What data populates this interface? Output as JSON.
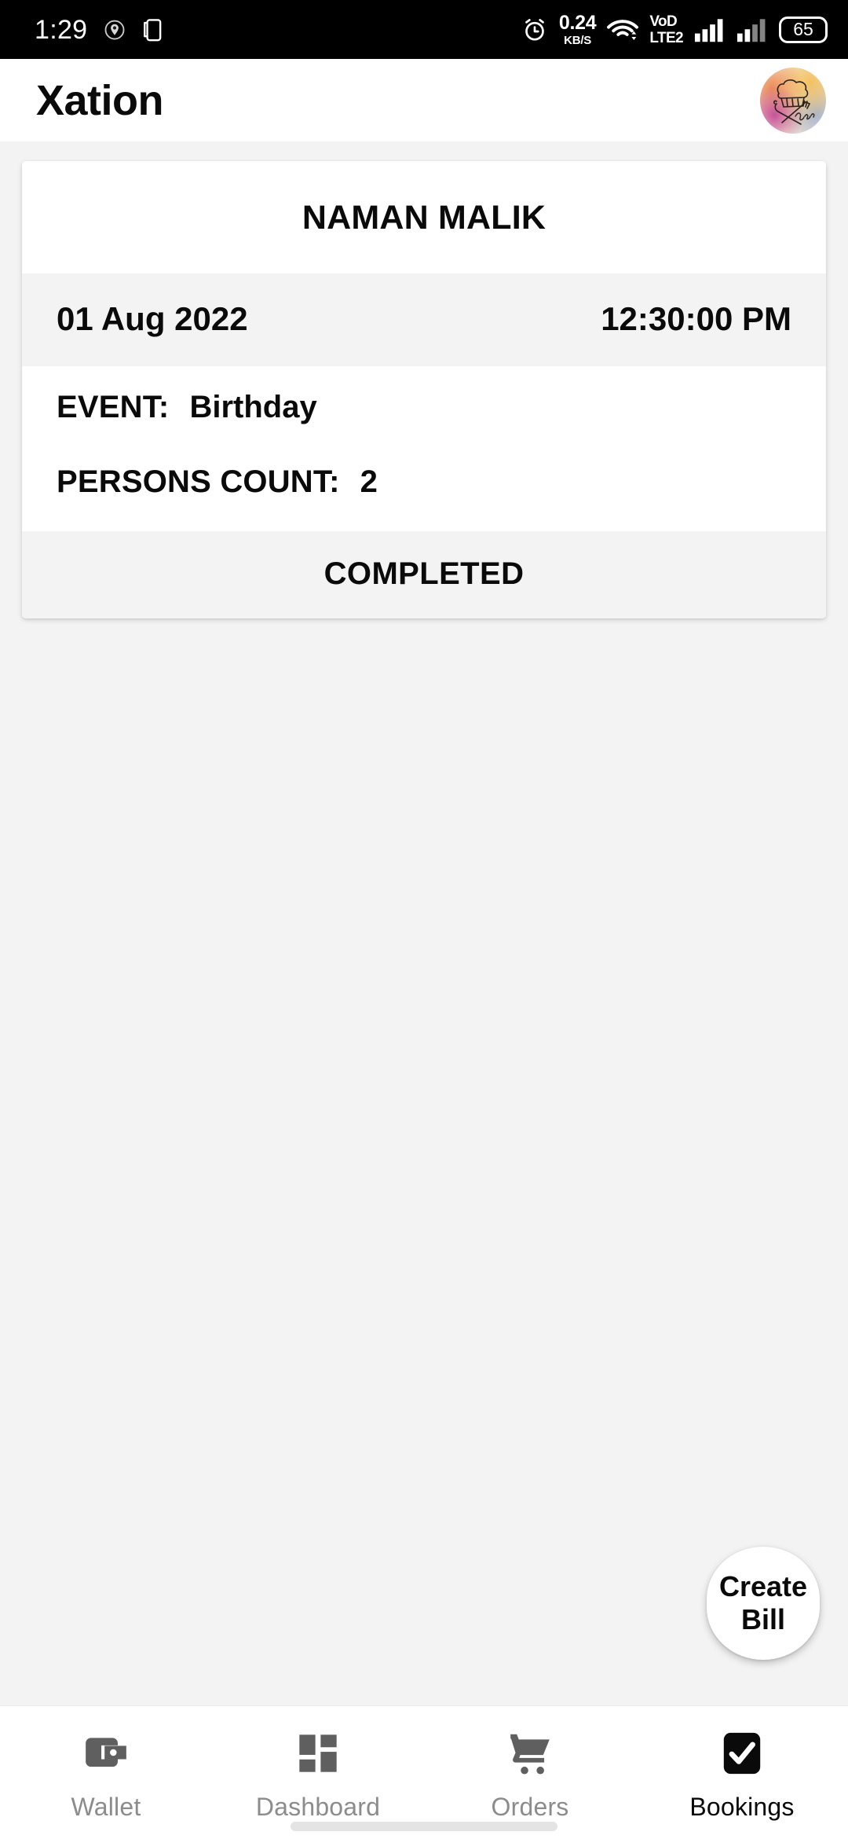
{
  "status_bar": {
    "clock": "1:29",
    "icons_left": [
      "location-pin-icon",
      "screenshot-icon"
    ],
    "alarm_icon": "alarm-clock-icon",
    "net_speed_rate": "0.24",
    "net_speed_unit": "KB/S",
    "wifi_icon": "wifi-icon",
    "volte_line1": "VoD",
    "volte_line2": "LTE2",
    "signal_icon_1": "signal-bars-icon",
    "signal_icon_2": "signal-bars-icon",
    "battery_level": "65"
  },
  "app_bar": {
    "title": "Xation",
    "avatar_name": "xation-logo-avatar"
  },
  "booking_card": {
    "customer_name": "NAMAN MALIK",
    "date": "01 Aug 2022",
    "time": "12:30:00 PM",
    "event_label": "EVENT:",
    "event_value": "Birthday",
    "persons_label": "PERSONS COUNT:",
    "persons_value": "2",
    "status": "COMPLETED"
  },
  "fab": {
    "line1": "Create",
    "line2": "Bill"
  },
  "bottom_nav": {
    "items": [
      {
        "label": "Wallet",
        "icon": "wallet-icon",
        "active": false
      },
      {
        "label": "Dashboard",
        "icon": "dashboard-grid-icon",
        "active": false
      },
      {
        "label": "Orders",
        "icon": "shopping-cart-icon",
        "active": false
      },
      {
        "label": "Bookings",
        "icon": "checkmark-icon",
        "active": true
      }
    ]
  },
  "colors": {
    "page_background": "#f4f3f4",
    "card_background": "#ffffff",
    "card_alt_row": "#f4f3f4",
    "status_bar": "#000000",
    "text_primary": "#0a0a0a",
    "nav_inactive": "#8c8c8c",
    "nav_active": "#0a0a0a",
    "nav_icon_inactive": "#5f5f5f"
  }
}
